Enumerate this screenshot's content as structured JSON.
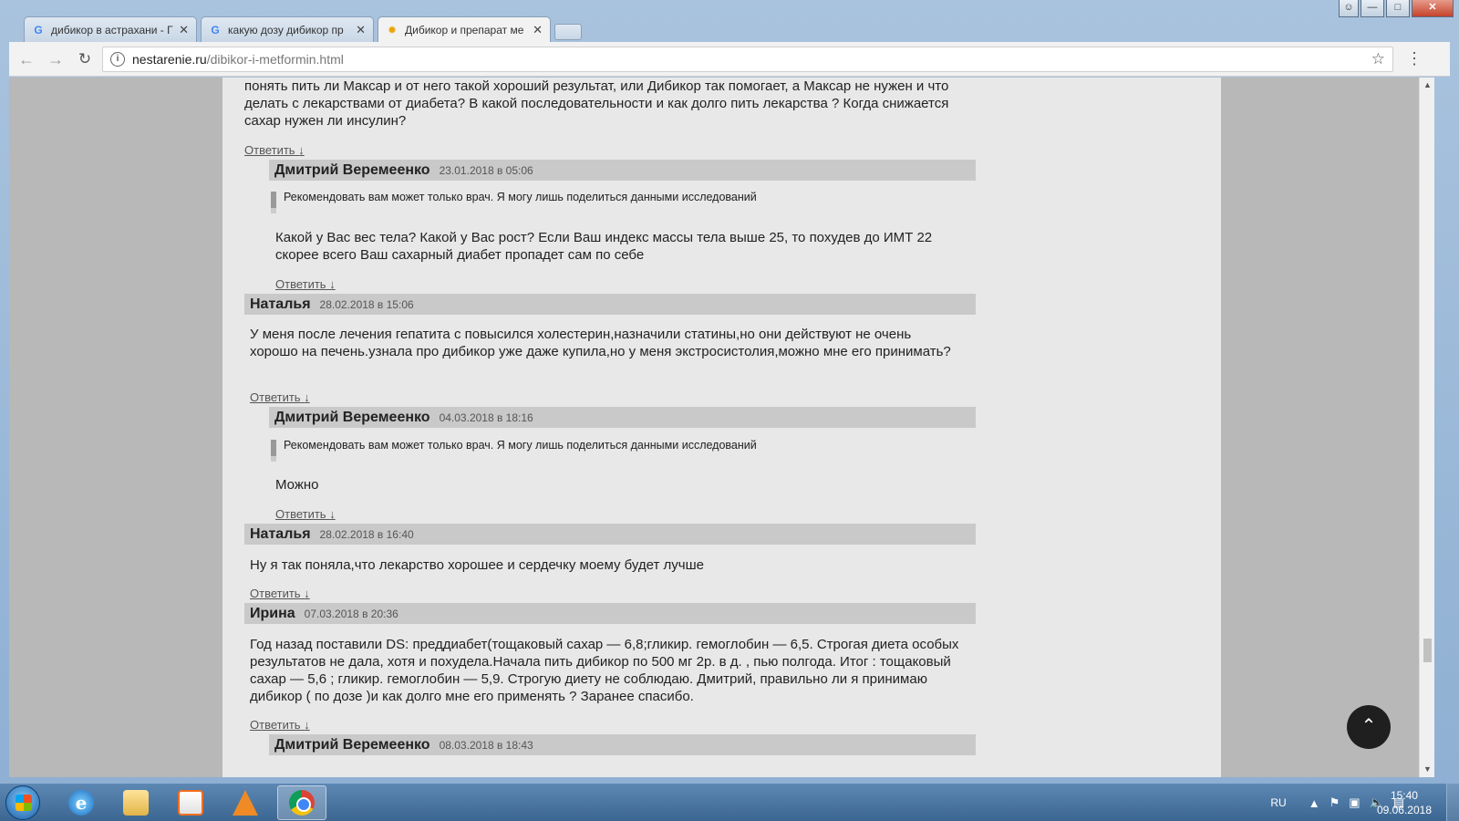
{
  "browser": {
    "tabs": [
      {
        "title": "дибикор в астрахани - Г",
        "icon": "google-icon"
      },
      {
        "title": "какую дозу дибикор пр",
        "icon": "google-icon"
      },
      {
        "title": "Дибикор и препарат ме",
        "icon": "site-favicon"
      }
    ],
    "url_host": "nestarenie.ru",
    "url_path": "/dibikor-i-metformin.html"
  },
  "page": {
    "top_text": "понять пить ли Максар и от него такой хороший результат, или Дибикор так помогает, а Максар не нужен и что делать с лекарствами от диабета? В какой последовательности и как долго пить лекарства ? Когда снижается сахар нужен ли инсулин?",
    "reply_label": "Ответить",
    "reply_arrow": "↓",
    "comments": [
      {
        "author": "Дмитрий Веремеенко",
        "date": "23.01.2018 в 05:06",
        "quote": "Рекомендовать вам может только врач. Я могу лишь поделиться данными исследований",
        "text": "Какой у Вас вес тела? Какой у Вас рост? Если Ваш индекс массы тела выше 25, то похудев до ИМТ 22 скорее всего Ваш сахарный диабет пропадет сам по себе"
      },
      {
        "author": "Наталья",
        "date": "28.02.2018 в 15:06",
        "text": "У меня после лечения гепатита с повысился холестерин,назначили статины,но они действуют не очень хорошо на печень.узнала про дибикор уже даже купила,но у меня экстросистолия,можно мне его принимать?"
      },
      {
        "author": "Дмитрий Веремеенко",
        "date": "04.03.2018 в 18:16",
        "quote": "Рекомендовать вам может только врач. Я могу лишь поделиться данными исследований",
        "text": "Можно"
      },
      {
        "author": "Наталья",
        "date": "28.02.2018 в 16:40",
        "text": "Ну я так поняла,что лекарство хорошее и сердечку моему будет лучше"
      },
      {
        "author": "Ирина",
        "date": "07.03.2018 в 20:36",
        "text": "Год назад поставили DS: преддиабет(тощаковый сахар — 6,8;гликир. гемоглобин — 6,5. Строгая диета особых результатов не дала, хотя и похудела.Начала пить дибикор по 500 мг 2р. в д. , пью полгода. Итог : тощаковый сахар — 5,6 ; гликир. гемоглобин — 5,9. Строгую диету не соблюдаю. Дмитрий, правильно ли я принимаю дибикор ( по дозе )и как долго мне его применять ? Заранее спасибо."
      },
      {
        "author": "Дмитрий Веремеенко",
        "date": "08.03.2018 в 18:43"
      }
    ]
  },
  "taskbar": {
    "language": "RU",
    "time": "15:40",
    "date": "09.06.2018"
  }
}
